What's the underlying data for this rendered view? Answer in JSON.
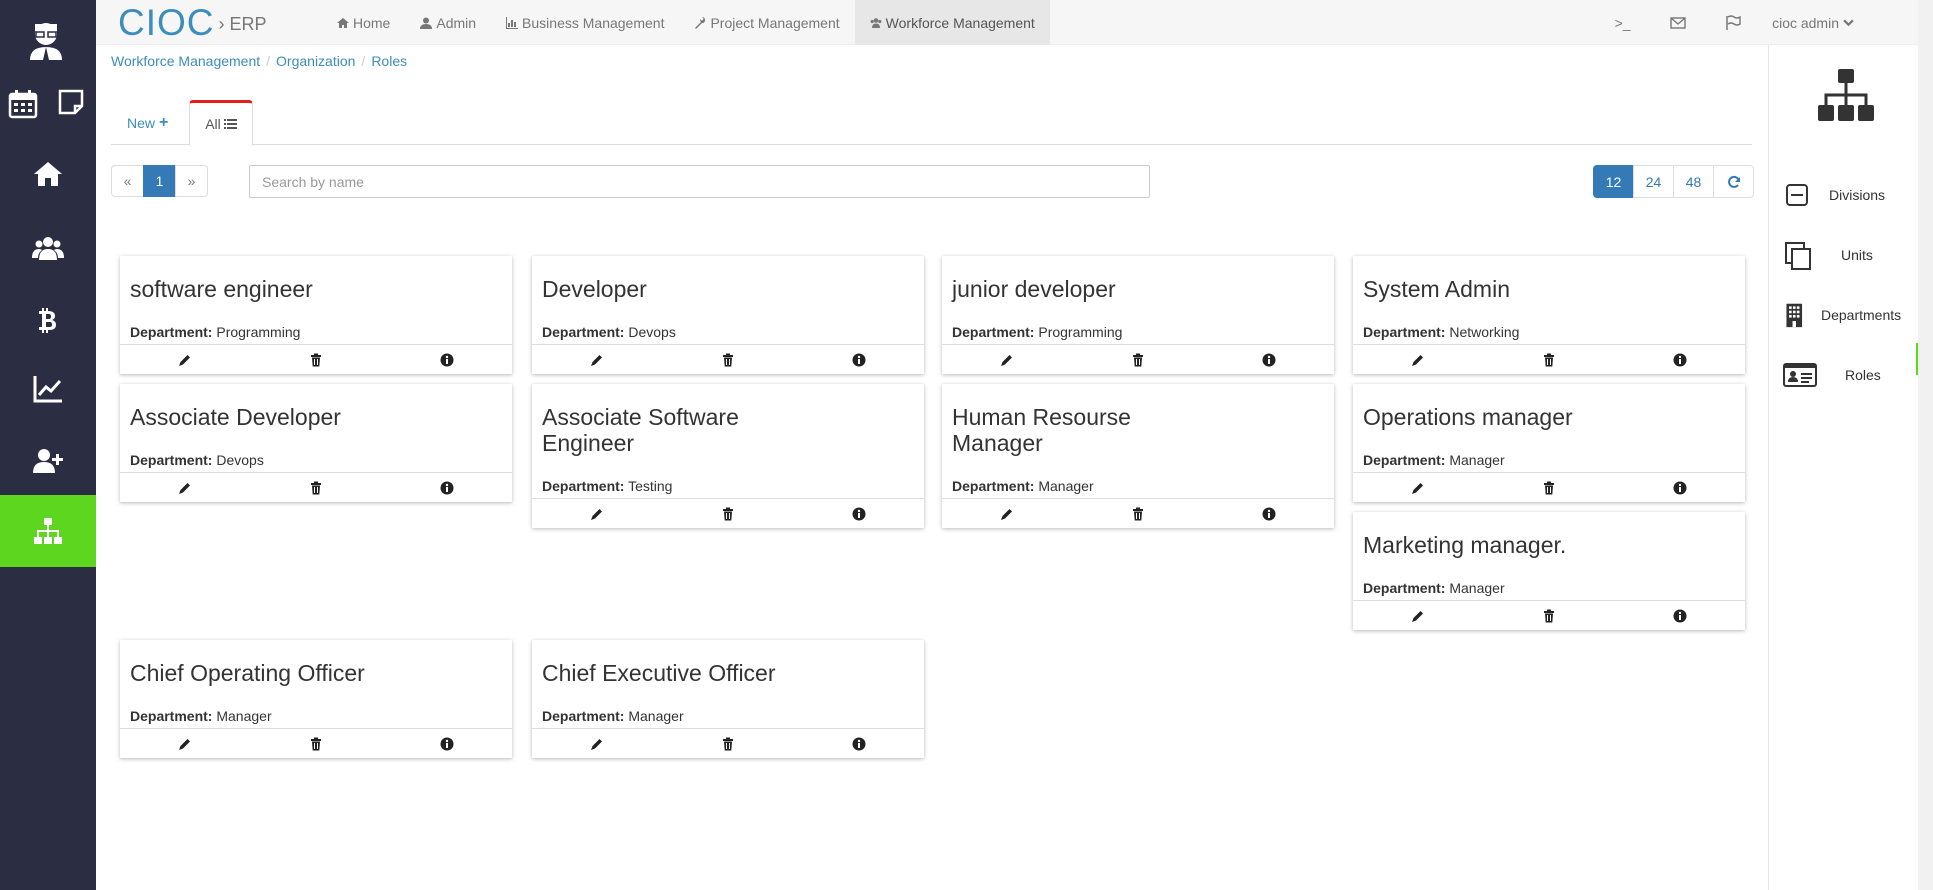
{
  "app": {
    "logo": "CIOC",
    "logo_suffix": "ERP"
  },
  "nav": {
    "items": [
      {
        "label": "Home",
        "icon": "home-icon"
      },
      {
        "label": "Admin",
        "icon": "user-icon"
      },
      {
        "label": "Business Management",
        "icon": "bar-chart-icon"
      },
      {
        "label": "Project Management",
        "icon": "wrench-icon"
      },
      {
        "label": "Workforce Management",
        "icon": "users-icon",
        "active": true
      }
    ],
    "terminal": ">_",
    "user": "cioc admin"
  },
  "breadcrumb": [
    "Workforce Management",
    "Organization",
    "Roles"
  ],
  "tabs": {
    "new_label": "New",
    "all_label": "All"
  },
  "pagination": {
    "prev": "«",
    "current": "1",
    "next": "»"
  },
  "search": {
    "placeholder": "Search by name"
  },
  "page_sizes": [
    "12",
    "24",
    "48"
  ],
  "page_size_active": "12",
  "right_panel": {
    "items": [
      {
        "label": "Divisions",
        "icon": "minus-square-icon"
      },
      {
        "label": "Units",
        "icon": "copy-icon"
      },
      {
        "label": "Departments",
        "icon": "building-icon"
      },
      {
        "label": "Roles",
        "icon": "id-card-icon"
      }
    ]
  },
  "dept_label": "Department:",
  "roles": [
    {
      "title": "software engineer",
      "department": "Programming"
    },
    {
      "title": "Developer",
      "department": "Devops"
    },
    {
      "title": "junior developer",
      "department": "Programming"
    },
    {
      "title": "System Admin",
      "department": "Networking"
    },
    {
      "title": "Associate Developer",
      "department": "Devops"
    },
    {
      "title": "Associate Software Engineer",
      "department": "Testing"
    },
    {
      "title": "Human Resourse Manager",
      "department": "Manager"
    },
    {
      "title": "Operations manager",
      "department": "Manager"
    },
    {
      "title": "Marketing manager.",
      "department": "Manager"
    },
    {
      "title": "Chief Operating Officer",
      "department": "Manager"
    },
    {
      "title": "Chief Executive Officer",
      "department": "Manager"
    }
  ],
  "colors": {
    "sidebar": "#2b2d42",
    "sidebar_active": "#5cd61f",
    "primary": "#337ab7",
    "link": "#3c8dbc",
    "tab_accent": "#e81c1c"
  }
}
